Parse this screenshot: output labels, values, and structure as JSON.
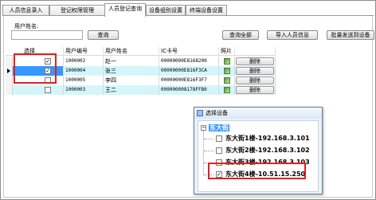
{
  "tabs": [
    "人员信息录入",
    "登记权限管理",
    "人员登记查询",
    "设备组别设置",
    "终端设备设置"
  ],
  "active_tab": 2,
  "form": {
    "name_label": "用户姓名:",
    "name_value": "",
    "query_button": "查询",
    "query_all_button": "查询全部",
    "import_button": "导入人员信息",
    "batch_send_button": "批量发送到设备"
  },
  "grid": {
    "columns": [
      "选择",
      "用户编号",
      "用户姓名",
      "IC卡号",
      "照片",
      ""
    ],
    "rows": [
      {
        "checked": true,
        "id": "1000002",
        "name": "赵一",
        "card": "00000000E8168200",
        "delete": "删除",
        "current": false
      },
      {
        "checked": true,
        "id": "1000004",
        "name": "张三",
        "card": "00000000E816F3CA",
        "delete": "删除",
        "current": true
      },
      {
        "checked": false,
        "id": "1000005",
        "name": "李四",
        "card": "00000000E816F3F7",
        "delete": "删除",
        "current": false
      },
      {
        "checked": false,
        "id": "1000003",
        "name": "王二",
        "card": "000000008178FFB0",
        "delete": "删除",
        "current": false
      }
    ]
  },
  "dialog": {
    "title": "选择设备",
    "root": "东大街",
    "devices": [
      {
        "label": "东大街1楼-192.168.3.101",
        "checked": false
      },
      {
        "label": "东大街2楼-192.168.3.102",
        "checked": false
      },
      {
        "label": "东大街3楼-192.168.3.103",
        "checked": false
      },
      {
        "label": "东大街4楼-10.51.15.250",
        "checked": true
      }
    ]
  },
  "colors": {
    "row_alt": "#d4f6fa",
    "row_selected": "#3399ff",
    "highlight_box": "#e02020"
  }
}
